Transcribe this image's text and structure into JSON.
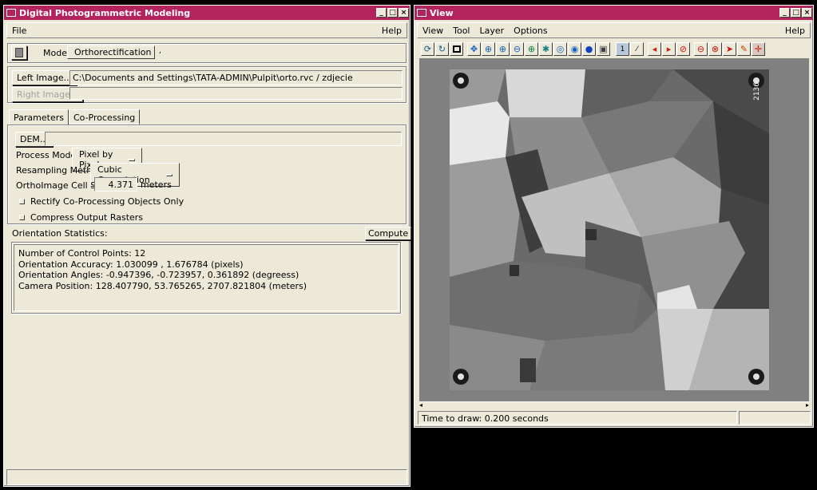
{
  "left_window": {
    "title": "Digital Photogrammetric Modeling",
    "menu": {
      "file": "File",
      "help": "Help"
    },
    "mode_label": "Mode:",
    "mode_value": "Orthorectification",
    "left_image_button": "Left Image...",
    "left_image_path": "C:\\Documents and Settings\\TATA-ADMIN\\Pulpit\\orto.rvc / zdjecie",
    "right_image_button": "Right Image...",
    "right_image_path": "",
    "tabs": [
      "Parameters",
      "Co-Processing"
    ],
    "dem_button": "DEM...",
    "dem_value": "",
    "process_mode_label": "Process Mode:",
    "process_mode_value": "Pixel by Pixel",
    "resampling_label": "Resampling Method:",
    "resampling_value": "Cubic Convolution",
    "cell_size_label": "OrthoImage Cell Size:",
    "cell_size_value": "4.371",
    "cell_size_unit": "meters",
    "rectify_label": "Rectify Co-Processing Objects Only",
    "compress_label": "Compress Output Rasters",
    "orientation_label": "Orientation Statistics:",
    "compute_button": "Compute",
    "stats": [
      "Number of Control Points: 12",
      "Orientation Accuracy: 1.030099 , 1.676784 (pixels)",
      "Orientation Angles: -0.947396, -0.723957, 0.361892 (degreess)",
      "Camera Position: 128.407790, 53.765265, 2707.821804 (meters)"
    ],
    "status": ""
  },
  "right_window": {
    "title": "View",
    "menu": [
      "View",
      "Tool",
      "Layer",
      "Options"
    ],
    "help": "Help",
    "toolbar_icons": [
      "redraw-icon",
      "redraw-all-icon",
      "extents-icon",
      "pan-icon",
      "zoom-box-icon",
      "zoom-in-icon",
      "zoom-out-icon",
      "zoom-layer-icon",
      "zoom-full-icon",
      "zoom-cursor-icon",
      "georef-icon",
      "scale-icon",
      "snapshot-icon",
      "one-to-one-icon",
      "measure-icon",
      "prev-view-icon",
      "next-view-icon",
      "cancel-icon",
      "zoom-out-red-icon",
      "stop-icon",
      "select-icon",
      "edit-tool-icon",
      "crosshair-icon"
    ],
    "photo_label": "2136",
    "status_text": "Time to draw: 0.200 seconds"
  },
  "colors": {
    "title_bar": "#b4245c",
    "panel": "#ece9d8"
  }
}
